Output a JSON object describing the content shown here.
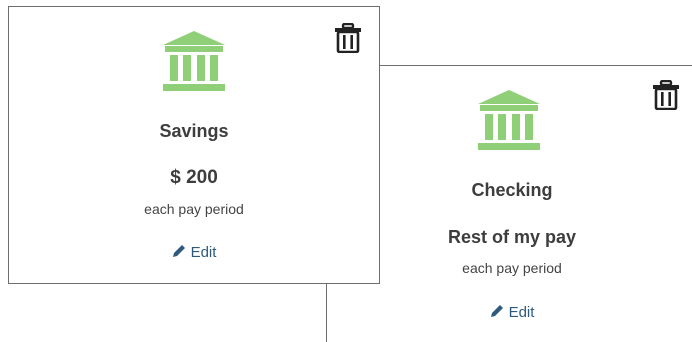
{
  "colors": {
    "accent": "#8ecf77",
    "link": "#2e5a7d",
    "text": "#3d3d3d"
  },
  "cards": [
    {
      "name": "Savings",
      "amount": "$ 200",
      "frequency": "each pay period",
      "edit_label": "Edit",
      "icon": "bank-icon",
      "delete_icon": "trash-icon"
    },
    {
      "name": "Checking",
      "amount": "Rest of my pay",
      "frequency": "each pay period",
      "edit_label": "Edit",
      "icon": "bank-icon",
      "delete_icon": "trash-icon"
    }
  ]
}
